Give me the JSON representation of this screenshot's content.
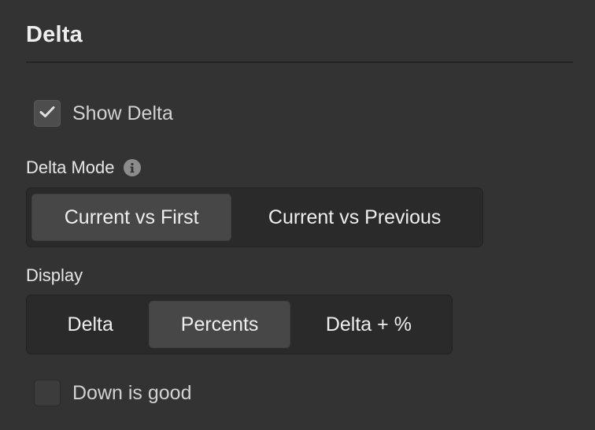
{
  "section": {
    "title": "Delta"
  },
  "show_delta": {
    "label": "Show Delta",
    "checked": true
  },
  "delta_mode": {
    "label": "Delta Mode",
    "info_icon": "info-icon",
    "options": [
      "Current vs First",
      "Current vs Previous"
    ],
    "selected": "Current vs First"
  },
  "display": {
    "label": "Display",
    "options": [
      "Delta",
      "Percents",
      "Delta + %"
    ],
    "selected": "Percents"
  },
  "down_is_good": {
    "label": "Down is good",
    "checked": false
  },
  "colors": {
    "background": "#333333",
    "segment_bg": "#2a2a2a",
    "segment_active": "#474747",
    "text": "#eeeeee"
  }
}
